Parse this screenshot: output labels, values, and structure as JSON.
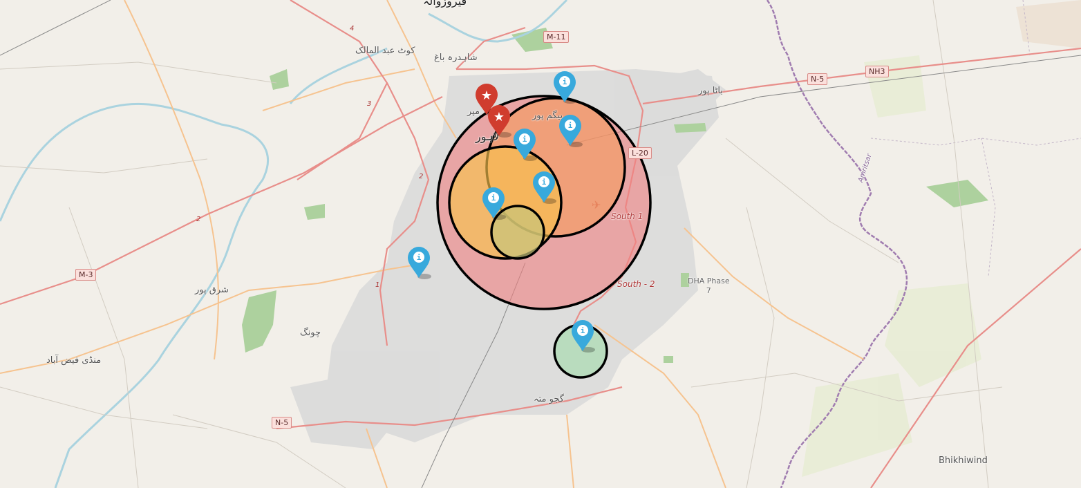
{
  "map": {
    "colors": {
      "land": "#f2efe9",
      "urban": "#d9d9d9",
      "primary_road": "#e88e8a",
      "secondary_road": "#f6c38f",
      "border": "#a07cb0",
      "water": "#aad3df",
      "park": "#add19e",
      "info_marker": "#38a9dc",
      "star_marker": "#d03c2e"
    },
    "place_labels": [
      {
        "key": "ferozewala",
        "text": "فیروزوالہ"
      },
      {
        "key": "kot_abdul_malik",
        "text": "کوٹ عبد المالک"
      },
      {
        "key": "shahdara_bagh",
        "text": "شاہدرہ باغ"
      },
      {
        "key": "baghbanpura",
        "text": "باٹا پور"
      },
      {
        "key": "lahore",
        "text": "لاہور"
      },
      {
        "key": "lahore_partial",
        "text": "مپر"
      },
      {
        "key": "mughalpura",
        "text": "بیگم پور"
      },
      {
        "key": "sharaqpur",
        "text": "شرق پور"
      },
      {
        "key": "chung",
        "text": "چونگ"
      },
      {
        "key": "mandi_faizabad",
        "text": "منڈی فیض آباد"
      },
      {
        "key": "gajjumatta",
        "text": "گجو متہ"
      },
      {
        "key": "dha",
        "text": "DHA Phase\n7"
      },
      {
        "key": "bhikhiwind",
        "text": "Bhikhiwind"
      },
      {
        "key": "amritsar",
        "text": "Amritsar"
      }
    ],
    "road_labels": [
      {
        "key": "south1",
        "text": "South 1"
      },
      {
        "key": "south2",
        "text": "South - 2"
      }
    ],
    "shields": [
      {
        "key": "m11",
        "text": "M-11"
      },
      {
        "key": "n5_east",
        "text": "N-5"
      },
      {
        "key": "nh3",
        "text": "NH3"
      },
      {
        "key": "l20",
        "text": "L-20"
      },
      {
        "key": "m3",
        "text": "M-3"
      },
      {
        "key": "n5_south",
        "text": "N-5"
      }
    ],
    "route_numbers": [
      "4",
      "3",
      "2",
      "2",
      "1"
    ],
    "circles": [
      {
        "key": "large-red",
        "fill": "#f08080"
      },
      {
        "key": "orange-ne",
        "fill": "#f59a55"
      },
      {
        "key": "yellow-center",
        "fill": "#f7c24d"
      },
      {
        "key": "olive-small",
        "fill": "#c8c47a"
      },
      {
        "key": "green-south",
        "fill": "#a9dbb0"
      }
    ],
    "markers": [
      {
        "type": "star",
        "icon": "star-icon"
      },
      {
        "type": "star",
        "icon": "star-icon"
      },
      {
        "type": "info",
        "icon": "info-icon"
      },
      {
        "type": "info",
        "icon": "info-icon"
      },
      {
        "type": "info",
        "icon": "info-icon"
      },
      {
        "type": "info",
        "icon": "info-icon"
      },
      {
        "type": "info",
        "icon": "info-icon"
      },
      {
        "type": "info",
        "icon": "info-icon"
      },
      {
        "type": "info",
        "icon": "info-icon"
      }
    ],
    "info_glyph": "i",
    "star_glyph": "★"
  }
}
